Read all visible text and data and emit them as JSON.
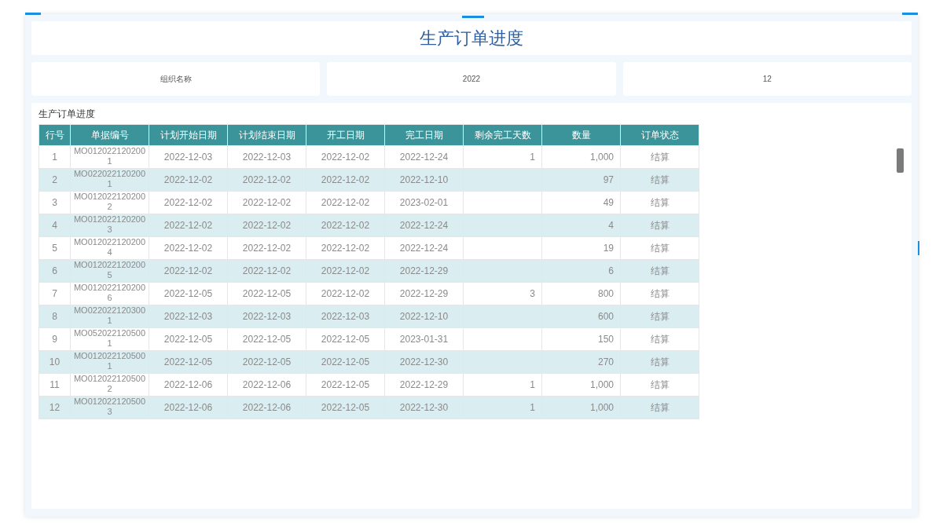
{
  "title": "生产订单进度",
  "filters": [
    "组织名称",
    "2022",
    "12"
  ],
  "panel": {
    "title": "生产订单进度",
    "table": {
      "columns": [
        "行号",
        "单据编号",
        "计划开始日期",
        "计划结束日期",
        "开工日期",
        "完工日期",
        "剩余完工天数",
        "数量",
        "订单状态"
      ],
      "rows": [
        [
          "1",
          "MO0120221202001",
          "2022-12-03",
          "2022-12-03",
          "2022-12-02",
          "2022-12-24",
          "1",
          "1,000",
          "结算"
        ],
        [
          "2",
          "MO0220221202001",
          "2022-12-02",
          "2022-12-02",
          "2022-12-02",
          "2022-12-10",
          "",
          "97",
          "结算"
        ],
        [
          "3",
          "MO0120221202002",
          "2022-12-02",
          "2022-12-02",
          "2022-12-02",
          "2023-02-01",
          "",
          "49",
          "结算"
        ],
        [
          "4",
          "MO0120221202003",
          "2022-12-02",
          "2022-12-02",
          "2022-12-02",
          "2022-12-24",
          "",
          "4",
          "结算"
        ],
        [
          "5",
          "MO0120221202004",
          "2022-12-02",
          "2022-12-02",
          "2022-12-02",
          "2022-12-24",
          "",
          "19",
          "结算"
        ],
        [
          "6",
          "MO0120221202005",
          "2022-12-02",
          "2022-12-02",
          "2022-12-02",
          "2022-12-29",
          "",
          "6",
          "结算"
        ],
        [
          "7",
          "MO0120221202006",
          "2022-12-05",
          "2022-12-05",
          "2022-12-02",
          "2022-12-29",
          "3",
          "800",
          "结算"
        ],
        [
          "8",
          "MO0220221203001",
          "2022-12-03",
          "2022-12-03",
          "2022-12-03",
          "2022-12-10",
          "",
          "600",
          "结算"
        ],
        [
          "9",
          "MO0520221205001",
          "2022-12-05",
          "2022-12-05",
          "2022-12-05",
          "2023-01-31",
          "",
          "150",
          "结算"
        ],
        [
          "10",
          "MO0120221205001",
          "2022-12-05",
          "2022-12-05",
          "2022-12-05",
          "2022-12-30",
          "",
          "270",
          "结算"
        ],
        [
          "11",
          "MO0120221205002",
          "2022-12-06",
          "2022-12-06",
          "2022-12-05",
          "2022-12-29",
          "1",
          "1,000",
          "结算"
        ],
        [
          "12",
          "MO0120221205003",
          "2022-12-06",
          "2022-12-06",
          "2022-12-05",
          "2022-12-30",
          "1",
          "1,000",
          "结算"
        ]
      ]
    }
  }
}
